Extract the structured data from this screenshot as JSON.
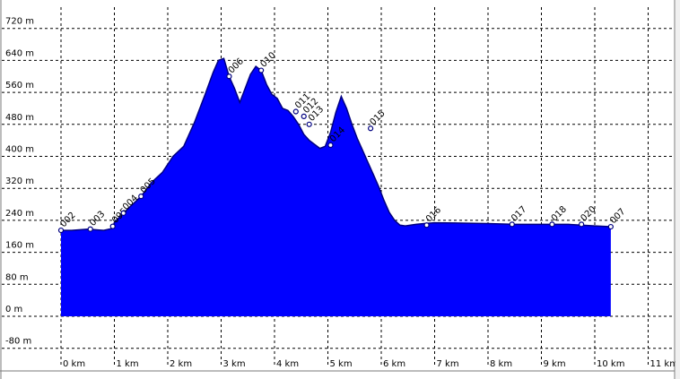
{
  "chart_data": {
    "type": "area",
    "title": "",
    "xlabel": "",
    "ylabel": "",
    "x_unit": "km",
    "y_unit": "m",
    "xlim": [
      0,
      11
    ],
    "ylim": [
      -80,
      720
    ],
    "x_ticks": [
      0,
      1,
      2,
      3,
      4,
      5,
      6,
      7,
      8,
      9,
      10,
      11
    ],
    "y_ticks": [
      -80,
      0,
      80,
      160,
      240,
      320,
      400,
      480,
      560,
      640,
      720
    ],
    "x_tick_labels": [
      "0 km",
      "1 km",
      "2 km",
      "3 km",
      "4 km",
      "5 km",
      "6 km",
      "7 km",
      "8 km",
      "9 km",
      "10 km",
      "11 km"
    ],
    "y_tick_labels": [
      "-80 m",
      "0 m",
      "80 m",
      "160 m",
      "240 m",
      "320 m",
      "400 m",
      "480 m",
      "560 m",
      "640 m",
      "720 m"
    ],
    "grid": true,
    "fill_color": "#0000ff",
    "line_color": "#000080",
    "series": [
      {
        "x": [
          0,
          0.2,
          0.5,
          0.8,
          0.97,
          1.0,
          1.15,
          1.3,
          1.5,
          1.7,
          1.9,
          2.1,
          2.3,
          2.5,
          2.7,
          2.85,
          2.95,
          3.05,
          3.15,
          3.25,
          3.35,
          3.45,
          3.55,
          3.65,
          3.75,
          3.85,
          3.95,
          4.05,
          4.15,
          4.25,
          4.35,
          4.45,
          4.55,
          4.65,
          4.75,
          4.85,
          4.95,
          5.05,
          5.15,
          5.25,
          5.35,
          5.45,
          5.55,
          5.65,
          5.75,
          5.85,
          5.95,
          6.05,
          6.15,
          6.25,
          6.35,
          6.45,
          6.55,
          6.65,
          6.8,
          7.0,
          7.5,
          8.0,
          8.5,
          9.0,
          9.5,
          10.0,
          10.3
        ],
        "y": [
          215,
          215,
          218,
          215,
          220,
          235,
          255,
          275,
          300,
          335,
          360,
          400,
          425,
          485,
          555,
          610,
          640,
          645,
          600,
          570,
          535,
          570,
          605,
          625,
          615,
          580,
          555,
          545,
          520,
          515,
          500,
          480,
          455,
          440,
          430,
          420,
          425,
          460,
          510,
          550,
          520,
          480,
          445,
          415,
          385,
          355,
          325,
          290,
          260,
          240,
          228,
          226,
          228,
          230,
          232,
          234,
          233,
          232,
          230,
          230,
          230,
          226,
          224
        ]
      }
    ],
    "waypoints": [
      {
        "label": "002",
        "x": 0.0,
        "y": 215
      },
      {
        "label": "003",
        "x": 0.55,
        "y": 218
      },
      {
        "label": "095",
        "x": 0.97,
        "y": 225
      },
      {
        "label": "004",
        "x": 1.17,
        "y": 258
      },
      {
        "label": "005",
        "x": 1.5,
        "y": 300
      },
      {
        "label": "006",
        "x": 3.15,
        "y": 600
      },
      {
        "label": "010",
        "x": 3.75,
        "y": 615
      },
      {
        "label": "011",
        "x": 4.4,
        "y": 512
      },
      {
        "label": "012",
        "x": 4.55,
        "y": 500
      },
      {
        "label": "013",
        "x": 4.65,
        "y": 480
      },
      {
        "label": "014",
        "x": 5.05,
        "y": 428
      },
      {
        "label": "015",
        "x": 5.8,
        "y": 470
      },
      {
        "label": "016",
        "x": 6.85,
        "y": 228
      },
      {
        "label": "017",
        "x": 8.45,
        "y": 230
      },
      {
        "label": "018",
        "x": 9.2,
        "y": 230
      },
      {
        "label": "020",
        "x": 9.75,
        "y": 230
      },
      {
        "label": "007",
        "x": 10.3,
        "y": 224
      }
    ]
  }
}
